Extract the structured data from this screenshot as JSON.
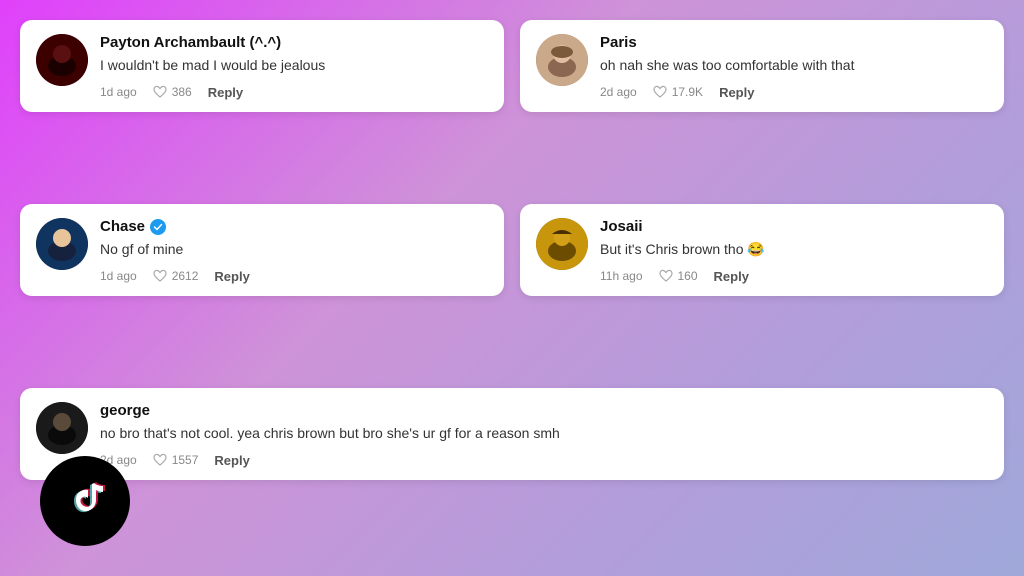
{
  "background": {
    "gradient": "linear-gradient(135deg, #e040fb, #ce93d8, #b39ddb, #9fa8da)"
  },
  "comments": [
    {
      "id": "payton",
      "username": "Payton Archambault (^.^)",
      "verified": false,
      "text": "I wouldn't be mad I would be jealous",
      "time": "1d ago",
      "likes": "386",
      "reply_label": "Reply",
      "avatar_color": "payton"
    },
    {
      "id": "paris",
      "username": "Paris",
      "verified": false,
      "text": "oh nah she was too comfortable with that",
      "time": "2d ago",
      "likes": "17.9K",
      "reply_label": "Reply",
      "avatar_color": "paris"
    },
    {
      "id": "chase",
      "username": "Chase",
      "verified": true,
      "text": "No gf of mine",
      "time": "1d ago",
      "likes": "2612",
      "reply_label": "Reply",
      "avatar_color": "chase"
    },
    {
      "id": "josaii",
      "username": "Josaii",
      "verified": false,
      "text": "But it's Chris brown tho 😂",
      "time": "11h ago",
      "likes": "160",
      "reply_label": "Reply",
      "avatar_color": "josaii"
    },
    {
      "id": "george",
      "username": "george",
      "verified": false,
      "text": "no bro that's not cool. yea chris brown but bro she's ur gf for a reason smh",
      "time": "2d ago",
      "likes": "1557",
      "reply_label": "Reply",
      "avatar_color": "george",
      "full_width": true
    }
  ],
  "tiktok": {
    "label": "TikTok"
  }
}
